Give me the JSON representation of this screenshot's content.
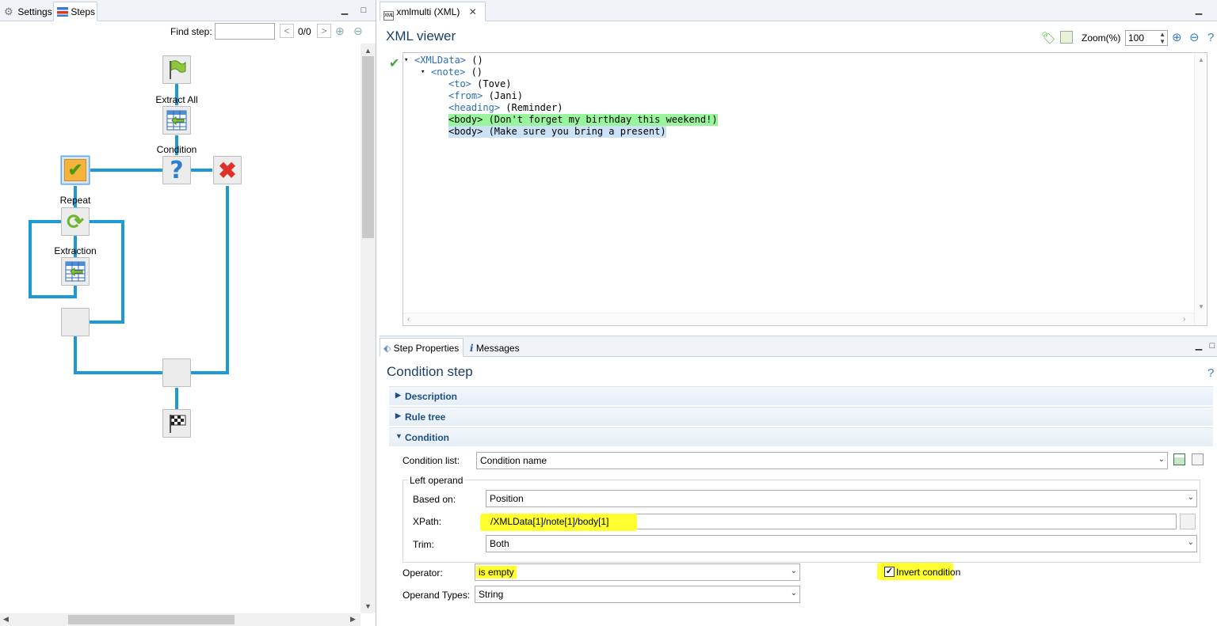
{
  "left_panel": {
    "tabs": [
      {
        "label": "Settings"
      },
      {
        "label": "Steps"
      }
    ],
    "find_step": {
      "label": "Find step:",
      "value": "",
      "count": "0/0",
      "prev": "<",
      "next": ">"
    },
    "flow": {
      "labels": {
        "extract_all": "Extract All",
        "condition": "Condition",
        "repeat": "Repeat",
        "extraction": "Extraction"
      }
    }
  },
  "xml_editor": {
    "tab_label": "xmlmulti (XML)",
    "title": "XML viewer",
    "zoom_label": "Zoom(%)",
    "zoom_value": "100",
    "lines": [
      {
        "tag": "<XMLData>",
        "value": " ()",
        "toggle": "▾",
        "highlight": "none"
      },
      {
        "tag": "<note>",
        "value": " ()",
        "toggle": "▾",
        "highlight": "none"
      },
      {
        "tag": "<to>",
        "value": " (Tove)",
        "toggle": "",
        "highlight": "none"
      },
      {
        "tag": "<from>",
        "value": " (Jani)",
        "toggle": "",
        "highlight": "none"
      },
      {
        "tag": "<heading>",
        "value": " (Reminder)",
        "toggle": "",
        "highlight": "none"
      },
      {
        "tag": "<body>",
        "value": " (Don't forget my birthday this weekend!)",
        "toggle": "",
        "highlight": "green"
      },
      {
        "tag": "<body>",
        "value": " (Make sure you bring a present)",
        "toggle": "",
        "highlight": "blue"
      }
    ],
    "colors": {
      "green_highlight": "#98f59b",
      "blue_highlight": "#cbe1f6"
    }
  },
  "properties": {
    "tabs": [
      {
        "label": "Step Properties"
      },
      {
        "label": "Messages"
      }
    ],
    "title": "Condition step",
    "sections": {
      "description": "Description",
      "rule_tree": "Rule tree",
      "condition": "Condition"
    },
    "condition_list": {
      "label": "Condition list:",
      "value": "Condition name"
    },
    "left_operand": {
      "group_label": "Left operand",
      "based_on": {
        "label": "Based on:",
        "value": "Position"
      },
      "xpath": {
        "label": "XPath:",
        "value": "/XMLData[1]/note[1]/body[1]"
      },
      "trim": {
        "label": "Trim:",
        "value": "Both"
      }
    },
    "operator": {
      "label": "Operator:",
      "value": "is empty"
    },
    "operand_types": {
      "label": "Operand Types:",
      "value": "String"
    },
    "invert_condition": {
      "label": "Invert condition",
      "checked": true
    },
    "highlight_color": "#ffff30"
  }
}
